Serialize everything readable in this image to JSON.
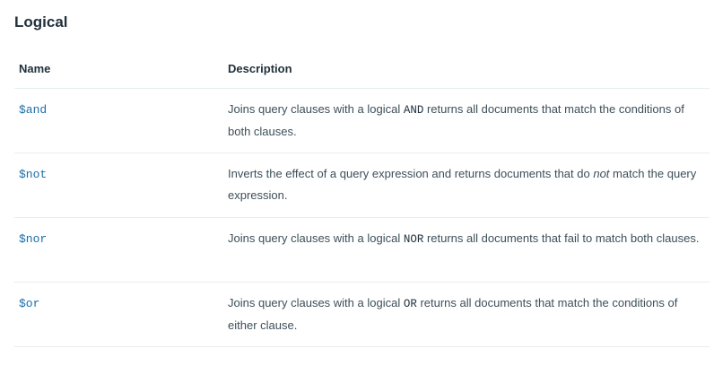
{
  "section": {
    "title": "Logical"
  },
  "table": {
    "headers": {
      "name": "Name",
      "description": "Description"
    },
    "rows": [
      {
        "name": "$and",
        "desc_before": "Joins query clauses with a logical ",
        "desc_code": "AND",
        "desc_after": " returns all documents that match the conditions of both clauses."
      },
      {
        "name": "$not",
        "desc_before": "Inverts the effect of a query expression and returns documents that do ",
        "desc_emph": "not",
        "desc_after": " match the query expression."
      },
      {
        "name": "$nor",
        "desc_before": "Joins query clauses with a logical ",
        "desc_code": "NOR",
        "desc_after": " returns all documents that fail to match both clauses."
      },
      {
        "name": "$or",
        "desc_before": "Joins query clauses with a logical ",
        "desc_code": "OR",
        "desc_after": " returns all documents that match the conditions of either clause."
      }
    ]
  },
  "colors": {
    "link": "#1a6ea8",
    "text": "#3d4f58",
    "heading": "#21313c",
    "divider": "#e7eeec"
  }
}
